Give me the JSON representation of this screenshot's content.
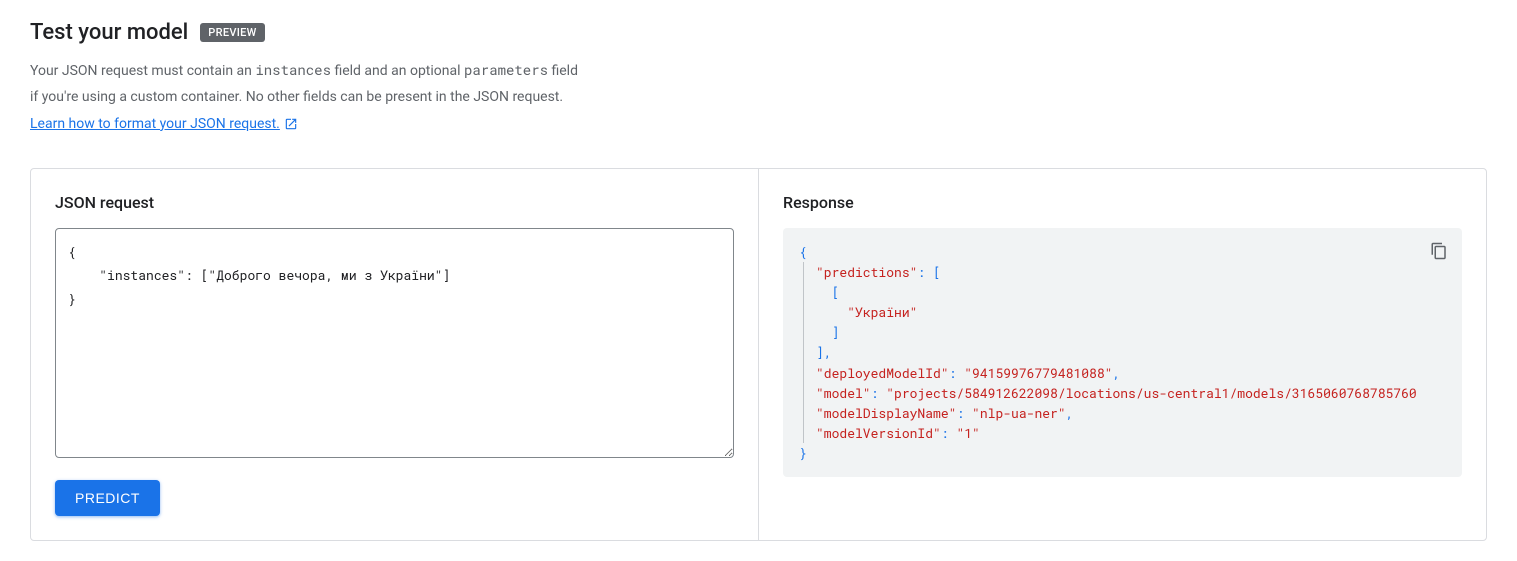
{
  "header": {
    "title": "Test your model",
    "badge": "PREVIEW"
  },
  "description": {
    "line1_prefix": "Your JSON request must contain an ",
    "code1": "instances",
    "line1_mid": " field and an optional ",
    "code2": "parameters",
    "line1_suffix": " field",
    "line2": "if you're using a custom container. No other fields can be present in the JSON request.",
    "link_text": "Learn how to format your JSON request."
  },
  "leftPanel": {
    "title": "JSON request",
    "requestBody": "{\n    \"instances\": [\"Доброго вечора, ми з України\"]\n}",
    "predictButton": "PREDICT"
  },
  "rightPanel": {
    "title": "Response",
    "response": {
      "predictions_key": "\"predictions\"",
      "prediction_value": "\"України\"",
      "deployedModelId_key": "\"deployedModelId\"",
      "deployedModelId_val": "\"94159976779481088\"",
      "model_key": "\"model\"",
      "model_val": "\"projects/584912622098/locations/us-central1/models/3165060768785760",
      "modelDisplayName_key": "\"modelDisplayName\"",
      "modelDisplayName_val": "\"nlp-ua-ner\"",
      "modelVersionId_key": "\"modelVersionId\"",
      "modelVersionId_val": "\"1\""
    }
  }
}
